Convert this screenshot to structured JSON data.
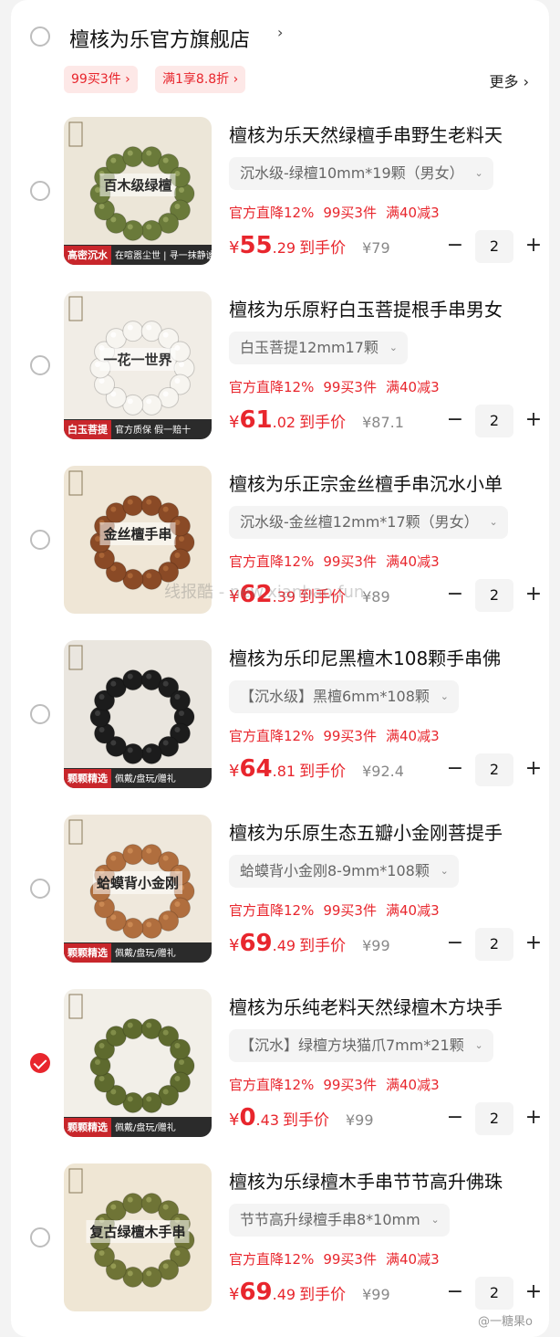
{
  "store": {
    "name": "檀核为乐官方旗舰店",
    "chevron": "›",
    "promos": [
      "99买3件 ›",
      "满1享8.8折 ›"
    ],
    "more": "更多 ›"
  },
  "items": [
    {
      "title": "檀核为乐天然绿檀手串野生老料天",
      "spec": "沉水级-绿檀10mm*19颗（男女）",
      "promos": [
        "官方直降12%",
        "99买3件",
        "满40减3"
      ],
      "price_symbol": "¥",
      "price_int": "55",
      "price_dec": ".29",
      "price_suffix": "到手价",
      "orig_price": "¥79",
      "qty": "2",
      "checked": false,
      "thumb": {
        "bg": "#ece6d8",
        "bead": "#6a7a3a",
        "bead_hi": "#9aa860",
        "banner_left": "高密沉水",
        "banner_right": "在喧嚣尘世 | 寻一抹静谧绿檀",
        "label": "百木级绿檀",
        "label_color": "#2a2a2a"
      }
    },
    {
      "title": "檀核为乐原籽白玉菩提根手串男女",
      "spec": "白玉菩提12mm17颗",
      "promos": [
        "官方直降12%",
        "99买3件",
        "满40减3"
      ],
      "price_symbol": "¥",
      "price_int": "61",
      "price_dec": ".02",
      "price_suffix": "到手价",
      "orig_price": "¥87.1",
      "qty": "2",
      "checked": false,
      "thumb": {
        "bg": "#f1ede6",
        "bead": "#f7f5f0",
        "bead_hi": "#ffffff",
        "banner_left": "白玉菩提",
        "banner_right": "官方质保 假一赔十",
        "label": "一花一世界",
        "label_color": "#333333"
      }
    },
    {
      "title": "檀核为乐正宗金丝檀手串沉水小单",
      "spec": "沉水级-金丝檀12mm*17颗（男女）",
      "promos": [
        "官方直降12%",
        "99买3件",
        "满40减3"
      ],
      "price_symbol": "¥",
      "price_int": "62",
      "price_dec": ".39",
      "price_suffix": "到手价",
      "orig_price": "¥89",
      "qty": "2",
      "checked": false,
      "thumb": {
        "bg": "#efe6d6",
        "bead": "#8a4a26",
        "bead_hi": "#b06a3a",
        "banner_left": "",
        "banner_right": "",
        "label": "金丝檀手串",
        "label_color": "#222222"
      }
    },
    {
      "title": "檀核为乐印尼黑檀木108颗手串佛",
      "spec": "【沉水级】黑檀6mm*108颗",
      "promos": [
        "官方直降12%",
        "99买3件",
        "满40减3"
      ],
      "price_symbol": "¥",
      "price_int": "64",
      "price_dec": ".81",
      "price_suffix": "到手价",
      "orig_price": "¥92.4",
      "qty": "2",
      "checked": false,
      "thumb": {
        "bg": "#eae6df",
        "bead": "#1c1c1c",
        "bead_hi": "#444444",
        "banner_left": "颗颗精选",
        "banner_right": "佩戴/盘玩/赠礼",
        "label": "",
        "label_color": "#222222"
      }
    },
    {
      "title": "檀核为乐原生态五瓣小金刚菩提手",
      "spec": "蛤蟆背小金刚8-9mm*108颗",
      "promos": [
        "官方直降12%",
        "99买3件",
        "满40减3"
      ],
      "price_symbol": "¥",
      "price_int": "69",
      "price_dec": ".49",
      "price_suffix": "到手价",
      "orig_price": "¥99",
      "qty": "2",
      "checked": false,
      "thumb": {
        "bg": "#efe8dc",
        "bead": "#b06e3e",
        "bead_hi": "#d18e58",
        "banner_left": "颗颗精选",
        "banner_right": "佩戴/盘玩/赠礼",
        "label": "蛤蟆背小金刚",
        "label_color": "#222222"
      }
    },
    {
      "title": "檀核为乐纯老料天然绿檀木方块手",
      "spec": "【沉水】绿檀方块猫爪7mm*21颗",
      "promos": [
        "官方直降12%",
        "99买3件",
        "满40减3"
      ],
      "price_symbol": "¥",
      "price_int": "0",
      "price_dec": ".43",
      "price_suffix": "到手价",
      "orig_price": "¥99",
      "qty": "2",
      "checked": true,
      "thumb": {
        "bg": "#f2efe8",
        "bead": "#5e6a2e",
        "bead_hi": "#8a9650",
        "banner_left": "颗颗精选",
        "banner_right": "佩戴/盘玩/赠礼",
        "label": "",
        "label_color": "#222222"
      }
    },
    {
      "title": "檀核为乐绿檀木手串节节高升佛珠",
      "spec": "节节高升绿檀手串8*10mm",
      "promos": [
        "官方直降12%",
        "99买3件",
        "满40减3"
      ],
      "price_symbol": "¥",
      "price_int": "69",
      "price_dec": ".49",
      "price_suffix": "到手价",
      "orig_price": "¥99",
      "qty": "2",
      "checked": false,
      "thumb": {
        "bg": "#efe6d4",
        "bead": "#6f7436",
        "bead_hi": "#9ca25a",
        "banner_left": "",
        "banner_right": "",
        "label": "复古绿檀木手串",
        "label_color": "#222222"
      }
    }
  ],
  "controls": {
    "minus": "−",
    "plus": "+",
    "spec_arrow": "⌄"
  },
  "watermark": "线报酷 - new.xianbao.fun",
  "weibo_tag": "@一糖果o"
}
